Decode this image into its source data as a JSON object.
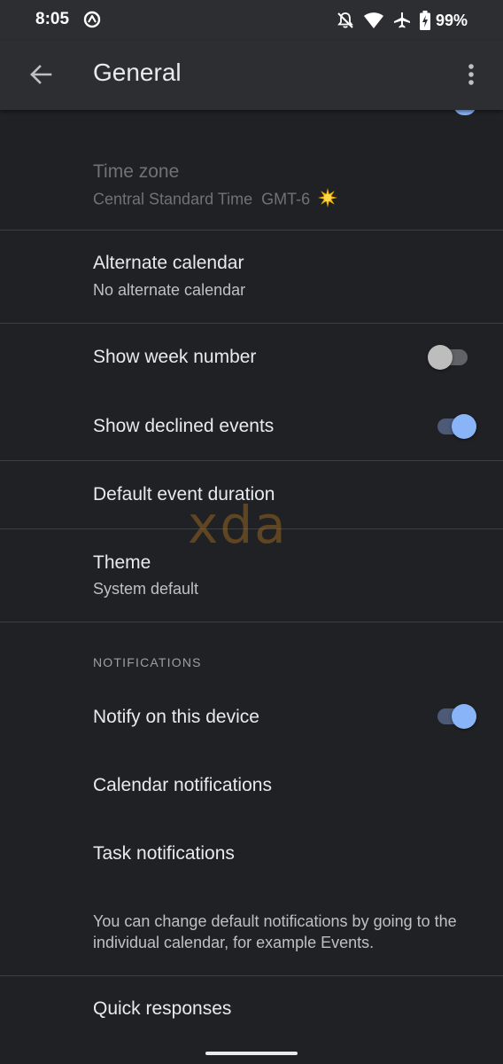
{
  "status_bar": {
    "time": "8:05",
    "battery": "99%",
    "icons": [
      "app-notification-icon",
      "notifications-off-icon",
      "wifi-icon",
      "airplane-icon",
      "battery-charging-icon"
    ]
  },
  "app_bar": {
    "title": "General",
    "back_icon": "arrow-back-icon",
    "menu_icon": "more-vert-icon"
  },
  "settings": {
    "time_zone": {
      "title": "Time zone",
      "subtitle": "Central Standard Time  GMT-6",
      "icon": "sun-emoji-icon",
      "enabled": false
    },
    "alternate_calendar": {
      "title": "Alternate calendar",
      "subtitle": "No alternate calendar"
    },
    "show_week_number": {
      "title": "Show week number",
      "enabled": false
    },
    "show_declined_events": {
      "title": "Show declined events",
      "enabled": true
    },
    "default_event_duration": {
      "title": "Default event duration"
    },
    "theme": {
      "title": "Theme",
      "subtitle": "System default"
    }
  },
  "notifications": {
    "header": "NOTIFICATIONS",
    "notify_on_device": {
      "title": "Notify on this device",
      "enabled": true
    },
    "calendar_notifications": {
      "title": "Calendar notifications"
    },
    "task_notifications": {
      "title": "Task notifications"
    },
    "info": "You can change default notifications by going to the individual calendar, for example Events."
  },
  "quick_responses": {
    "title": "Quick responses"
  },
  "watermark": "xda",
  "colors": {
    "background": "#202124",
    "app_bar": "#2d2e31",
    "accent": "#8ab4f8",
    "divider": "#3c4043"
  }
}
